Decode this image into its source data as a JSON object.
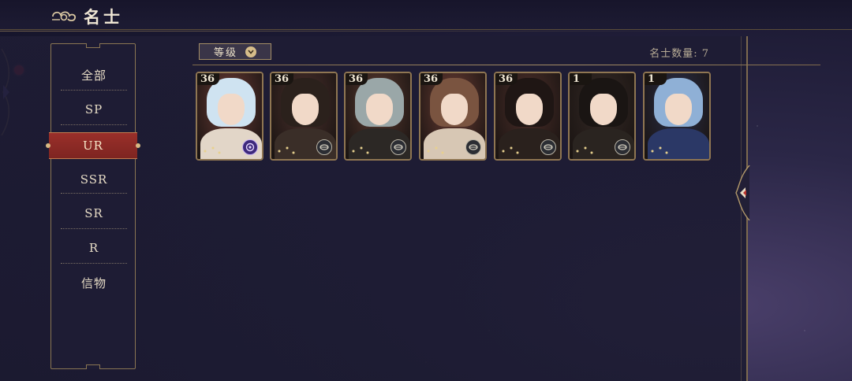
{
  "header": {
    "title": "名士"
  },
  "sidebar": {
    "items": [
      {
        "label": "全部",
        "active": false
      },
      {
        "label": "SP",
        "active": false
      },
      {
        "label": "UR",
        "active": true
      },
      {
        "label": "SSR",
        "active": false
      },
      {
        "label": "SR",
        "active": false
      },
      {
        "label": "R",
        "active": false
      },
      {
        "label": "信物",
        "active": false
      }
    ]
  },
  "filter": {
    "sort_label": "等级"
  },
  "count": {
    "text": "名士数量: 7"
  },
  "cards": [
    {
      "level": "36",
      "badge": "orb-badge",
      "palette": {
        "bg": "#6a3b35",
        "hair": "#cfe3f1",
        "robe": "#e2d6c8"
      }
    },
    {
      "level": "36",
      "badge": "compass-badge",
      "palette": {
        "bg": "#4a302c",
        "hair": "#2b211c",
        "robe": "#3a2e28"
      }
    },
    {
      "level": "36",
      "badge": "compass-badge",
      "palette": {
        "bg": "#5a3a30",
        "hair": "#9aa7a8",
        "robe": "#2c2825"
      }
    },
    {
      "level": "36",
      "badge": "compass-badge",
      "palette": {
        "bg": "#6b3d34",
        "hair": "#7a5440",
        "robe": "#d7c7b4"
      }
    },
    {
      "level": "36",
      "badge": "compass-badge",
      "palette": {
        "bg": "#4d2f2a",
        "hair": "#1f1614",
        "robe": "#2a211d"
      }
    },
    {
      "level": "1",
      "badge": "compass-badge",
      "palette": {
        "bg": "#352a26",
        "hair": "#1a1513",
        "robe": "#2a2420"
      }
    },
    {
      "level": "1",
      "badge": "none",
      "palette": {
        "bg": "#2a2f4a",
        "hair": "#8fb0d6",
        "robe": "#2b3866"
      }
    }
  ]
}
